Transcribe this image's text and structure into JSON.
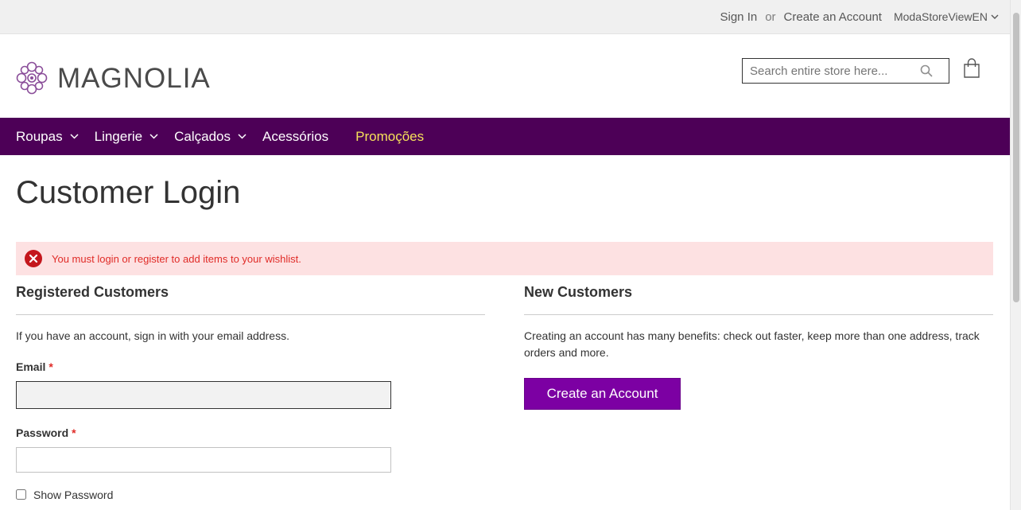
{
  "header": {
    "sign_in": "Sign In",
    "or": "or",
    "create_account": "Create an Account",
    "store_view": "ModaStoreViewEN",
    "logo_text": "MAGNOLIA",
    "search_placeholder": "Search entire store here...",
    "brand_color": "#4d0057"
  },
  "nav": {
    "items": [
      {
        "label": "Roupas"
      },
      {
        "label": "Lingerie"
      },
      {
        "label": "Calçados"
      },
      {
        "label": "Acessórios"
      },
      {
        "label": "Promoções"
      }
    ]
  },
  "page": {
    "title": "Customer Login",
    "error_message": "You must login or register to add items to your wishlist."
  },
  "registered": {
    "title": "Registered Customers",
    "intro": "If you have an account, sign in with your email address.",
    "email_label": "Email",
    "password_label": "Password",
    "required_mark": "*",
    "show_password_label": "Show Password"
  },
  "new_customers": {
    "title": "New Customers",
    "text": "Creating an account has many benefits: check out faster, keep more than one address, track orders and more.",
    "button_label": "Create an Account"
  },
  "colors": {
    "nav_bg": "#4d0057",
    "promo_text": "#f6e15a",
    "button_bg": "#7c00a3",
    "error_bg": "#fde1e2",
    "error_text": "#e02b27"
  }
}
